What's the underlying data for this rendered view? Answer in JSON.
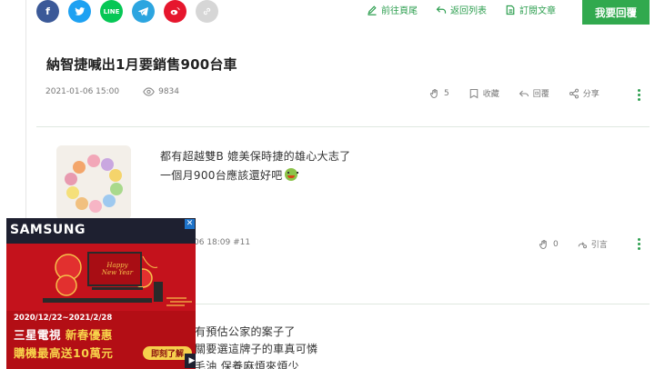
{
  "share": {
    "items": [
      {
        "icon": "facebook-icon",
        "color": "#3b5998",
        "glyph": "f"
      },
      {
        "icon": "twitter-icon",
        "color": "#1da1f2"
      },
      {
        "icon": "line-icon",
        "color": "#06c755",
        "glyph": "LINE"
      },
      {
        "icon": "telegram-icon",
        "color": "#2ca5e0"
      },
      {
        "icon": "weibo-icon",
        "color": "#e6162d"
      },
      {
        "icon": "link-icon",
        "color": "#d6d6d6"
      }
    ]
  },
  "toolbar": {
    "go_last": "前往頁尾",
    "back_to_list": "返回列表",
    "subscribe": "訂閱文章",
    "reply": "我要回覆"
  },
  "post": {
    "title": "納智捷喊出1月要銷售900台車",
    "date": "2021-01-06 15:00",
    "views": "9834",
    "likes": "5",
    "bookmark": "收藏",
    "reply": "回覆",
    "share": "分享"
  },
  "comment": {
    "line1": "都有超越雙B 媲美保時捷的雄心大志了",
    "line2": "一個月900台應該還好吧",
    "date_floor": "06 18:09 #11",
    "likes": "0",
    "quote": "引言"
  },
  "comment2": {
    "line1": "有預估公家的案子了",
    "line2": "關要選這牌子的車真可憐",
    "line3": "毛油  保養麻煩來煩少"
  },
  "ad": {
    "brand": "SAMSUNG",
    "banner_text": "Happy New Year",
    "dates": "2020/12/22~2021/2/28",
    "headline": "三星電視",
    "headline_sub": "新春優惠",
    "promo": "購機最高送10萬元",
    "cta": "即刻了解",
    "close": "✕"
  },
  "colors": {
    "accent": "#2e9f50",
    "button": "#31a94e",
    "ad_red": "#b30e15"
  }
}
